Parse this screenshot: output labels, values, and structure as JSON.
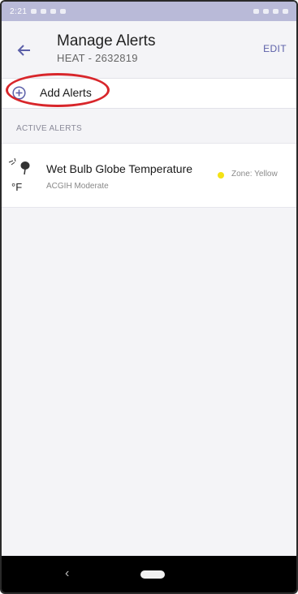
{
  "status_bar": {
    "time": "2:21"
  },
  "header": {
    "title": "Manage Alerts",
    "subtitle": "HEAT - 2632819",
    "edit_label": "EDIT",
    "back_icon": "arrow-left-icon"
  },
  "add_alerts": {
    "label": "Add Alerts",
    "icon": "plus-circle-icon",
    "highlight_color": "#d8262b"
  },
  "active_alerts": {
    "section_label": "ACTIVE ALERTS",
    "items": [
      {
        "title": "Wet Bulb Globe Temperature",
        "subtitle": "ACGIH Moderate",
        "unit": "°F",
        "zone_label": "Zone: Yellow",
        "zone_color": "#f4e215",
        "icon": "heat-stress-icon"
      }
    ]
  },
  "colors": {
    "accent": "#5b5fa8",
    "status_bar": "#b9bad8",
    "background": "#f4f4f7"
  },
  "nav_bar": {
    "back_icon": "nav-back-icon",
    "home_icon": "nav-home-pill-icon"
  }
}
